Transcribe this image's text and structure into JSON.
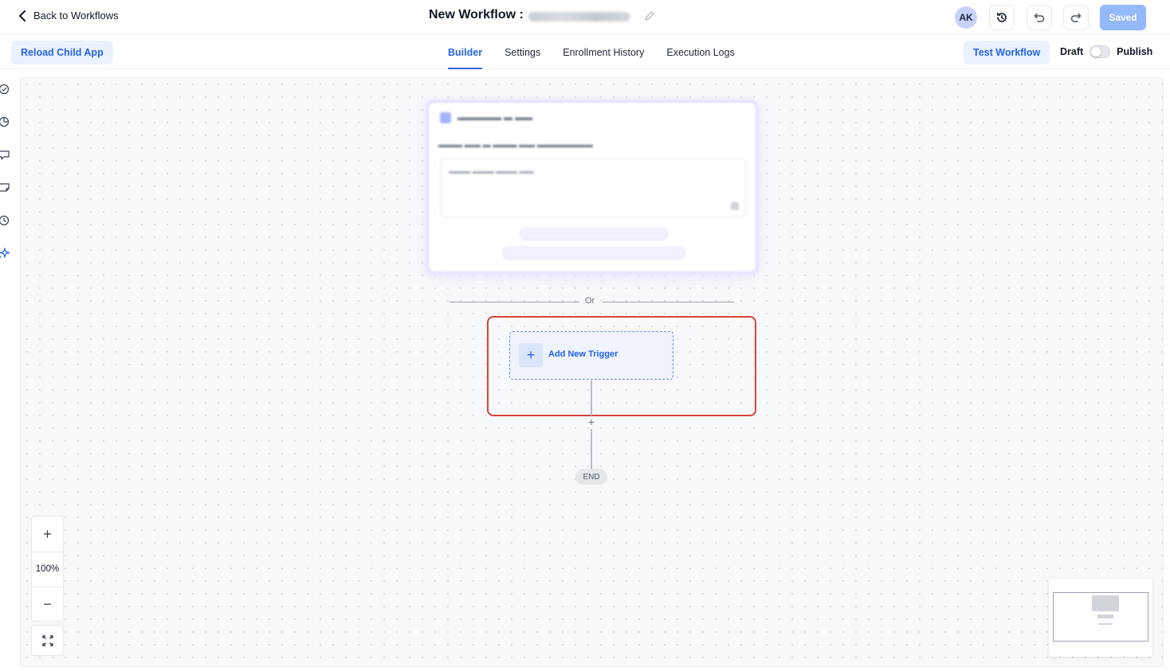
{
  "header": {
    "back_label": "Back to Workflows",
    "workflow_title": "New Workflow :",
    "avatar_initials": "AK",
    "saved_label": "Saved"
  },
  "subbar": {
    "reload_label": "Reload Child App",
    "tabs": [
      {
        "label": "Builder",
        "active": true
      },
      {
        "label": "Settings",
        "active": false
      },
      {
        "label": "Enrollment History",
        "active": false
      },
      {
        "label": "Execution Logs",
        "active": false
      }
    ],
    "test_label": "Test Workflow",
    "draft_label": "Draft",
    "publish_label": "Publish",
    "published": false
  },
  "sidebar": {
    "icons": [
      "check-circle-icon",
      "pie-chart-icon",
      "chat-icon",
      "note-icon",
      "history-icon",
      "sparkle-icon"
    ]
  },
  "canvas": {
    "or_label": "Or",
    "trigger_label": "Add New Trigger",
    "end_label": "END",
    "zoom_level": "100%"
  },
  "colors": {
    "accent": "#2563eb",
    "highlight": "#d9443a",
    "saved_button": "#93b8fb"
  }
}
